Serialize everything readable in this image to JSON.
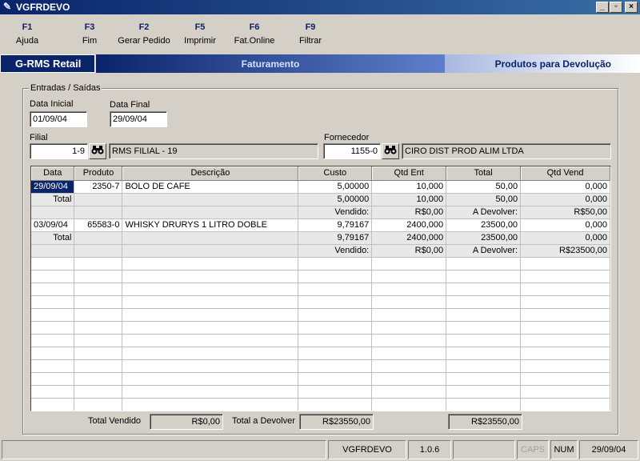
{
  "window": {
    "title": "VGFRDEVO",
    "btn_min": "_",
    "btn_max": "▫",
    "btn_close": "×"
  },
  "toolbar": [
    {
      "key": "F1",
      "label": "Ajuda"
    },
    {
      "key": "F3",
      "label": "Fim"
    },
    {
      "key": "F2",
      "label": "Gerar Pedido"
    },
    {
      "key": "F5",
      "label": "Imprimir"
    },
    {
      "key": "F6",
      "label": "Fat.Online"
    },
    {
      "key": "F9",
      "label": "Filtrar"
    }
  ],
  "banner": {
    "brand": "G-RMS Retail",
    "module": "Faturamento",
    "screen": "Produtos para Devolução"
  },
  "group": {
    "label": "Entradas / Saídas"
  },
  "filters": {
    "data_inicial_label": "Data Inicial",
    "data_inicial": "01/09/04",
    "data_final_label": "Data Final",
    "data_final": "29/09/04",
    "filial_label": "Filial",
    "filial_code": "1-9",
    "filial_name": "RMS FILIAL - 19",
    "fornecedor_label": "Fornecedor",
    "fornecedor_code": "1155-0",
    "fornecedor_name": "CIRO DIST PROD ALIM LTDA"
  },
  "grid": {
    "columns": [
      "Data",
      "Produto",
      "Descrição",
      "Custo",
      "Qtd Ent",
      "Total",
      "Qtd Vend"
    ],
    "rows": [
      [
        "29/09/04",
        "2350-7",
        "BOLO DE CAFE",
        "5,00000",
        "10,000",
        "50,00",
        "0,000"
      ],
      [
        "Total",
        "",
        "",
        "5,00000",
        "10,000",
        "50,00",
        "0,000"
      ],
      [
        "",
        "",
        "",
        "Vendido:",
        "R$0,00",
        "A Devolver:",
        "R$50,00"
      ],
      [
        "03/09/04",
        "65583-0",
        "WHISKY DRURYS 1 LITRO DOBLE",
        "9,79167",
        "2400,000",
        "23500,00",
        "0,000"
      ],
      [
        "Total",
        "",
        "",
        "9,79167",
        "2400,000",
        "23500,00",
        "0,000"
      ],
      [
        "",
        "",
        "",
        "Vendido:",
        "R$0,00",
        "A Devolver:",
        "R$23500,00"
      ]
    ]
  },
  "totals": {
    "vendido_label": "Total Vendido",
    "vendido": "R$0,00",
    "devolver_label": "Total a Devolver",
    "devolver": "R$23550,00",
    "grand": "R$23550,00"
  },
  "statusbar": {
    "program": "VGFRDEVO",
    "version": "1.0.6",
    "caps": "CAPS",
    "num": "NUM",
    "date": "29/09/04"
  }
}
